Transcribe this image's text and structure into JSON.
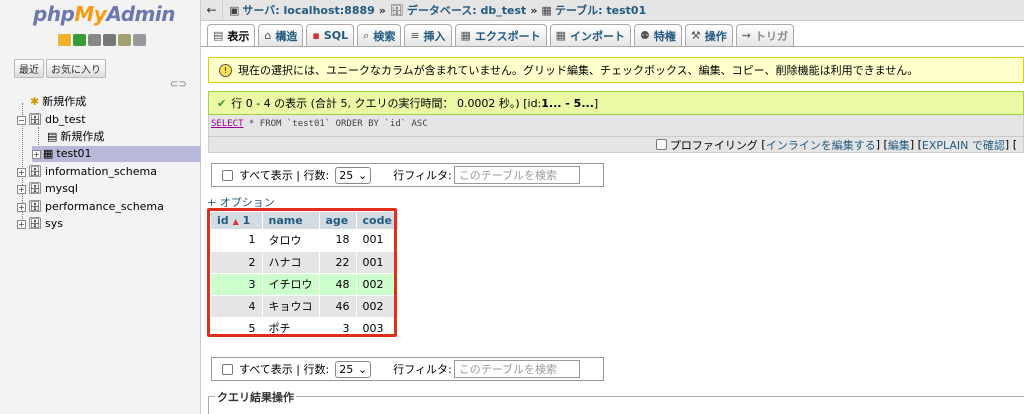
{
  "nav": {
    "logo": {
      "php": "php",
      "my": "My",
      "admin": "Admin"
    },
    "recent_label": "最近",
    "favorites_label": "お気に入り",
    "tree": {
      "new_top": "新規作成",
      "db_test": "db_test",
      "new_child": "新規作成",
      "test01": "test01",
      "information_schema": "information_schema",
      "mysql": "mysql",
      "performance_schema": "performance_schema",
      "sys": "sys"
    }
  },
  "breadcrumb": {
    "server": "サーバ: localhost:8889",
    "database": "データベース: db_test",
    "table": "テーブル: test01"
  },
  "tabs": [
    {
      "label": "表示",
      "icon": "table-icon"
    },
    {
      "label": "構造",
      "icon": "structure-icon"
    },
    {
      "label": "SQL",
      "icon": "sql-icon"
    },
    {
      "label": "検索",
      "icon": "search-icon"
    },
    {
      "label": "挿入",
      "icon": "insert-icon"
    },
    {
      "label": "エクスポート",
      "icon": "export-icon"
    },
    {
      "label": "インポート",
      "icon": "import-icon"
    },
    {
      "label": "特権",
      "icon": "privileges-icon"
    },
    {
      "label": "操作",
      "icon": "operations-icon"
    },
    {
      "label": "トリガ",
      "icon": "triggers-icon"
    }
  ],
  "notice": "現在の選択には、ユニークなカラムが含まれていません。グリッド編集、チェックボックス、編集、コピー、削除機能は利用できません。",
  "success": {
    "text_a": "行 0 - 4 の表示 (合計 5, クエリの実行時間： 0.0002 秒。) [id: ",
    "text_b": "1... - 5...",
    "text_c": "]"
  },
  "sql": {
    "select": "SELECT",
    "rest": " * FROM `test01` ORDER BY `id` ASC"
  },
  "profiling": {
    "label": "プロファイリング",
    "edit_inline": "インラインを編集する",
    "edit": "編集",
    "explain": "EXPLAIN で確認"
  },
  "navbar": {
    "show_all": "すべて表示",
    "rows_label": "行数:",
    "rows_value": "25",
    "filter_label": "行フィルタ:",
    "filter_placeholder": "このテーブルを検索"
  },
  "options_link": "+ オプション",
  "table": {
    "columns": [
      "id",
      "name",
      "age",
      "code"
    ],
    "sort_index": "1",
    "rows": [
      {
        "id": "1",
        "name": "タロウ",
        "age": "18",
        "code": "001"
      },
      {
        "id": "2",
        "name": "ハナコ",
        "age": "22",
        "code": "001"
      },
      {
        "id": "3",
        "name": "イチロウ",
        "age": "48",
        "code": "002"
      },
      {
        "id": "4",
        "name": "キョウコ",
        "age": "46",
        "code": "002"
      },
      {
        "id": "5",
        "name": "ポチ",
        "age": "3",
        "code": "003"
      }
    ]
  },
  "result_ops": "クエリ結果操作",
  "colors": {
    "link": "#235a81",
    "highlight_row": "#ccffcc",
    "annotation_box": "#e32e1e",
    "success_bg": "#ebf8a4",
    "notice_bg": "#ffffcc"
  }
}
